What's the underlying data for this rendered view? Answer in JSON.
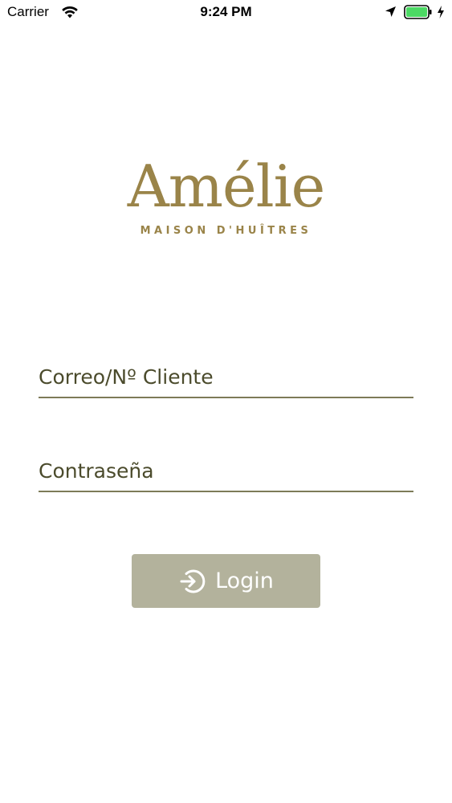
{
  "status_bar": {
    "carrier": "Carrier",
    "time": "9:24 PM",
    "icons": [
      "wifi-icon",
      "location-icon",
      "battery-icon",
      "charging-bolt-icon"
    ],
    "battery_color": "#4cd964"
  },
  "logo": {
    "wordmark": "Amélie",
    "tagline": "MAISON D'HUÎTRES",
    "color": "#9a8449"
  },
  "form": {
    "email_placeholder": "Correo/Nº Cliente",
    "email_value": "",
    "password_placeholder": "Contraseña",
    "password_value": "",
    "underline_color": "#7d7b58",
    "text_color": "#4b4b2c"
  },
  "login_button": {
    "label": "Login",
    "icon": "login-arrow-icon",
    "background": "#b3b29c"
  }
}
